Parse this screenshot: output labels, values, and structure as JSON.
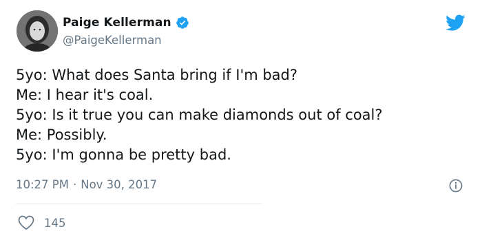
{
  "author": {
    "display_name": "Paige Kellerman",
    "handle": "@PaigeKellerman"
  },
  "tweet": {
    "lines": [
      "5yo: What does Santa bring if I'm bad?",
      "Me: I hear it's coal.",
      "5yo: Is it true you can make diamonds out of coal?",
      "Me: Possibly.",
      "5yo: I'm gonna be pretty bad."
    ],
    "time": "10:27 PM",
    "separator": "·",
    "date": "Nov 30, 2017",
    "like_count": "145"
  },
  "icons": {
    "verified": "verified-badge-icon",
    "brand": "twitter-bird-icon",
    "info": "info-icon",
    "like": "heart-icon"
  },
  "colors": {
    "brand": "#1da1f2",
    "text": "#14171a",
    "secondary": "#657786",
    "divider": "#e1e8ed"
  }
}
